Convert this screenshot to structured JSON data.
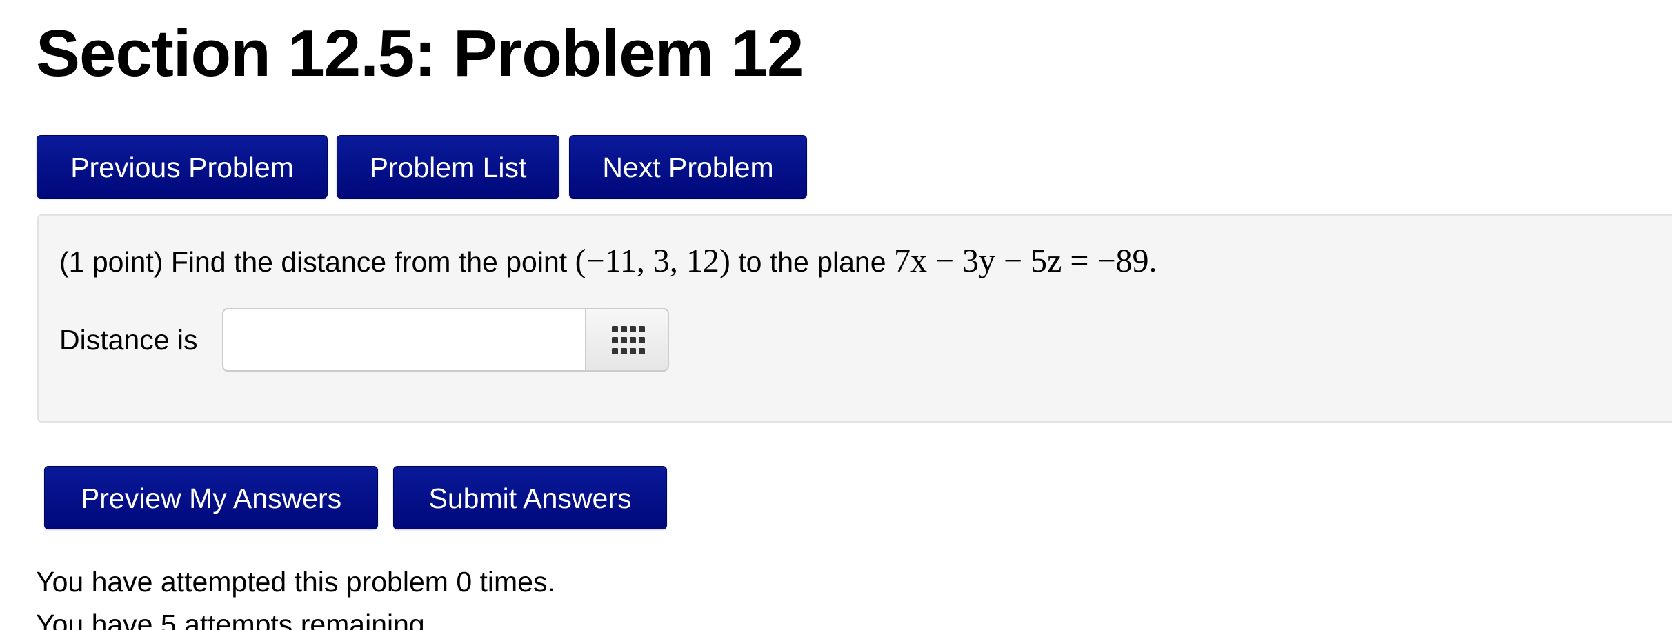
{
  "page": {
    "title": "Section 12.5: Problem 12"
  },
  "nav": {
    "previous_label": "Previous Problem",
    "list_label": "Problem List",
    "next_label": "Next Problem"
  },
  "problem": {
    "points": "(1 point)",
    "prompt_start": "Find the distance from the point",
    "point": "(−11, 3, 12)",
    "prompt_mid": "to the plane",
    "plane_equation": "7x − 3y − 5z = −89."
  },
  "answer": {
    "label": "Distance is",
    "value": "",
    "palette_icon": "grid-icon"
  },
  "actions": {
    "preview_label": "Preview My Answers",
    "submit_label": "Submit Answers"
  },
  "status": {
    "attempts": "You have attempted this problem 0 times.",
    "remaining": "You have 5 attempts remaining."
  },
  "colors": {
    "button_bg": "#00087a",
    "problem_bg": "#f5f5f5"
  }
}
